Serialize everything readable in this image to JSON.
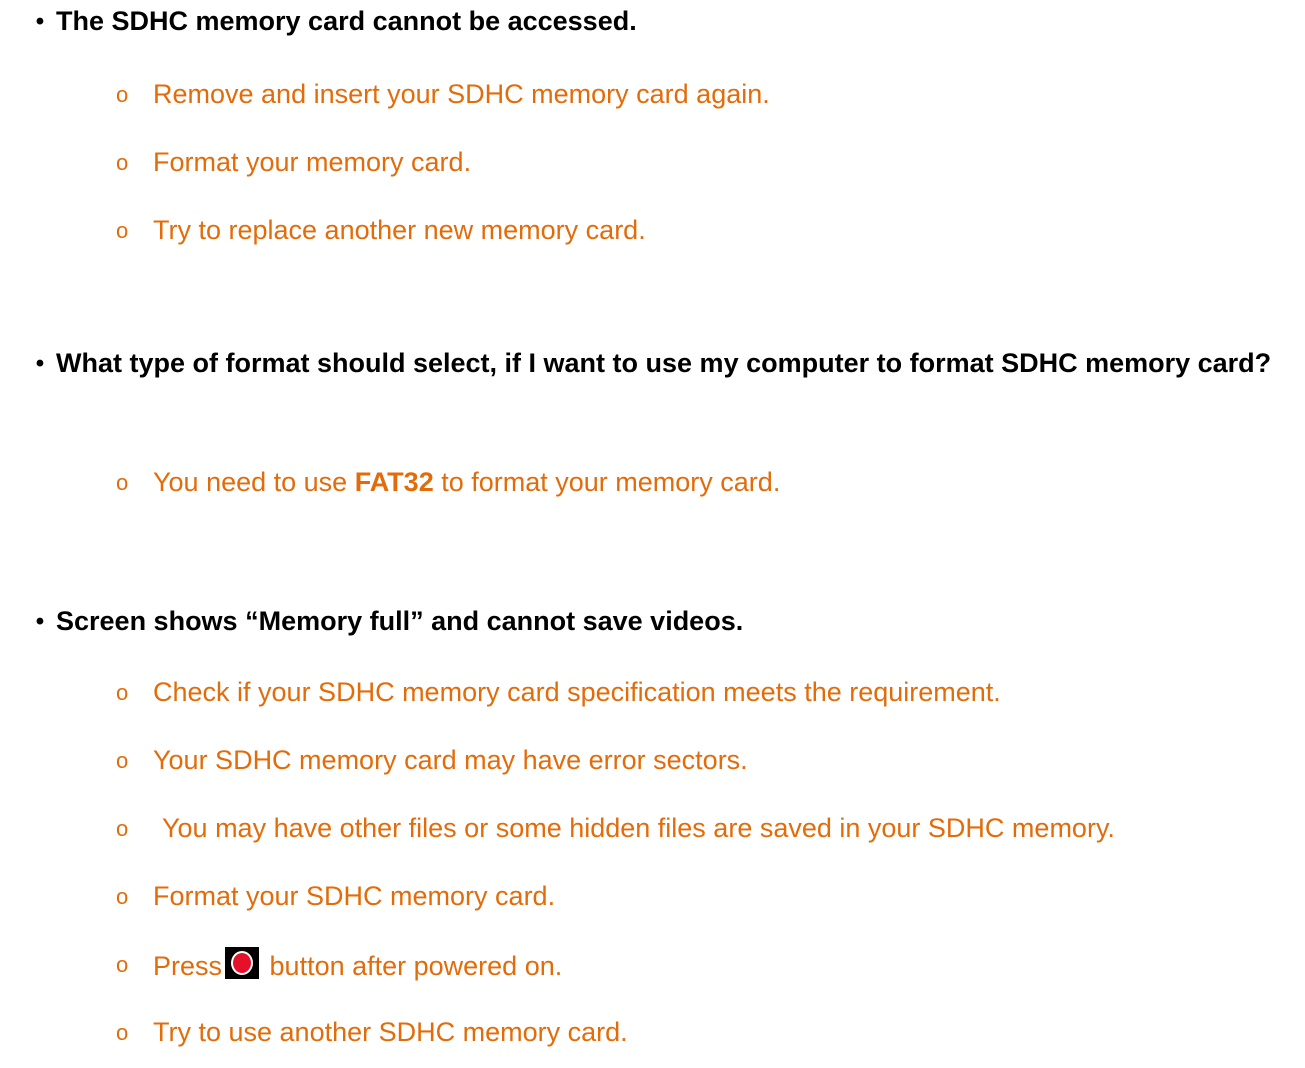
{
  "colors": {
    "question": "#000000",
    "answer": "#E36C0A",
    "icon_bg": "#000000",
    "icon_fill": "#E5102A"
  },
  "bullet_glyph": "•",
  "sub_bullet_glyph": "o",
  "faq": [
    {
      "question": "The SDHC memory card cannot be accessed.",
      "answers": [
        "Remove and insert your SDHC memory card again.",
        "Format your memory card.",
        "Try to replace another new memory card."
      ]
    },
    {
      "question": "What type of format should select, if I want to use my computer to format SDHC memory card?",
      "answer_fat32": {
        "before": "You need to use ",
        "bold": "FAT32",
        "after": " to format your memory card."
      }
    },
    {
      "question": "Screen shows “Memory full” and cannot save videos.",
      "answers": [
        "Check if your SDHC memory card specification meets the requirement.",
        "Your SDHC memory card may have error sectors.",
        "You may have other files or some hidden files are saved in your SDHC memory.",
        "Format your SDHC memory card."
      ],
      "press_item": {
        "before": "Press",
        "icon": "record-button-icon",
        "after": " button after powered on."
      },
      "last_answer": "Try to use another SDHC memory card."
    }
  ]
}
